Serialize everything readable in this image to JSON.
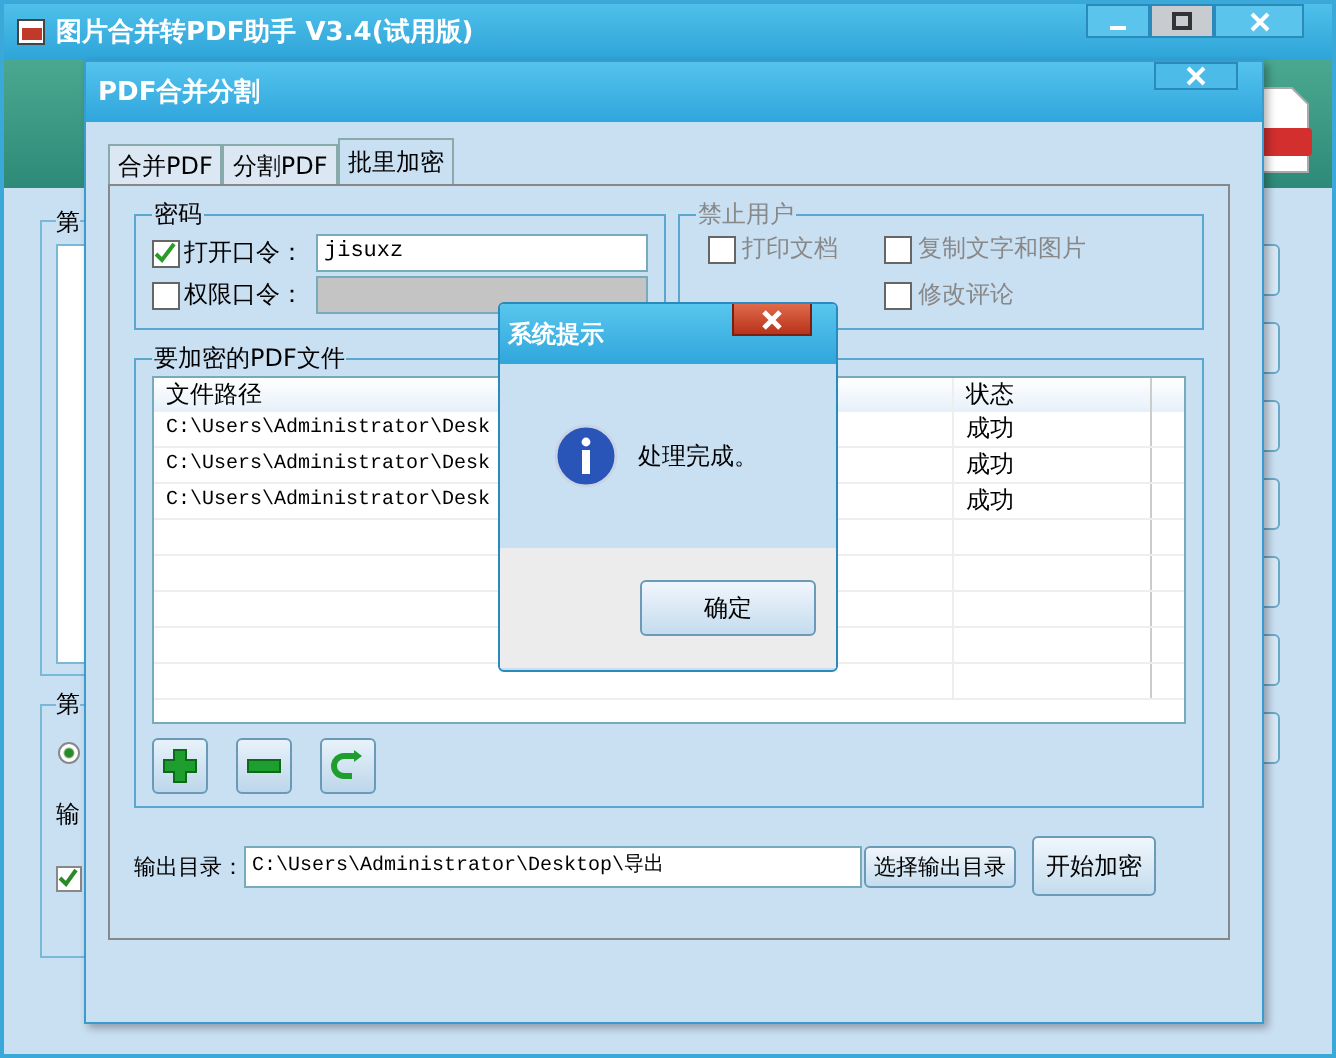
{
  "main_window": {
    "title": "图片合并转PDF助手 V3.4(试用版)",
    "fragments": [
      {
        "kind": "text",
        "text": "第"
      },
      {
        "kind": "text",
        "text": "第"
      },
      {
        "kind": "text",
        "text": "输"
      }
    ],
    "radio": {
      "selected": true
    },
    "checkbox": {
      "checked": true
    }
  },
  "dialog": {
    "title": "PDF合并分割",
    "tabs": [
      {
        "label": "合并PDF",
        "selected": false
      },
      {
        "label": "分割PDF",
        "selected": false
      },
      {
        "label": "批里加密",
        "selected": true
      }
    ],
    "password_group": {
      "title": "密码",
      "fields": [
        {
          "label": "打开口令：",
          "checked": true,
          "disabled": false,
          "value": "jisuxz"
        },
        {
          "label": "权限口令：",
          "checked": false,
          "disabled": true
        }
      ]
    },
    "restrict_group": {
      "title": "禁止用户",
      "options": [
        {
          "label": "打印文档",
          "checked": false
        },
        {
          "label": "复制文字和图片",
          "checked": false
        },
        {
          "label": "修改评论",
          "checked": false
        }
      ]
    },
    "files_group": {
      "title": "要加密的PDF文件",
      "columns": [
        "文件路径",
        "状态"
      ],
      "rows": [
        {
          "path": "C:\\Users\\Administrator\\Desk",
          "status": "成功"
        },
        {
          "path": "C:\\Users\\Administrator\\Desk",
          "status": "成功"
        },
        {
          "path": "C:\\Users\\Administrator\\Desk",
          "status": "成功"
        }
      ]
    },
    "output": {
      "label": "输出目录：",
      "value": "C:\\Users\\Administrator\\Desktop\\导出",
      "browse_button": "选择输出目录",
      "start_button": "开始加密"
    }
  },
  "message_box": {
    "title": "系统提示",
    "message": "处理完成。",
    "ok_button": "确定"
  }
}
